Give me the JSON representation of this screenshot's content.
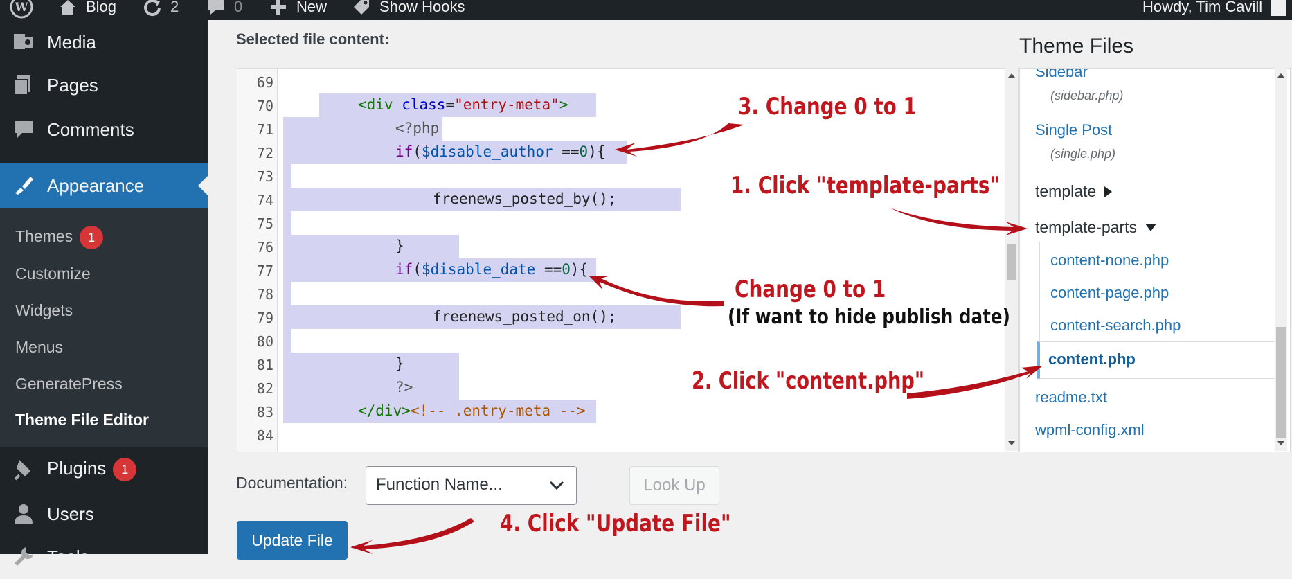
{
  "admin_bar": {
    "blog_label": "Blog",
    "updates_count": "2",
    "comments_count": "0",
    "new_label": "New",
    "hooks_label": "Show Hooks",
    "greeting": "Howdy, Tim Cavill"
  },
  "sidebar": {
    "media": "Media",
    "pages": "Pages",
    "comments": "Comments",
    "appearance": "Appearance",
    "submenu": [
      {
        "label": "Themes",
        "badge": "1"
      },
      {
        "label": "Customize"
      },
      {
        "label": "Widgets"
      },
      {
        "label": "Menus"
      },
      {
        "label": "GeneratePress"
      },
      {
        "label": "Theme File Editor"
      }
    ],
    "plugins": "Plugins",
    "plugins_badge": "1",
    "users": "Users",
    "tools": "Tools"
  },
  "editor": {
    "label": "Selected file content:",
    "line_numbers": [
      "69",
      "70",
      "71",
      "72",
      "73",
      "74",
      "75",
      "76",
      "77",
      "78",
      "79",
      "80",
      "81",
      "82",
      "83",
      "84"
    ]
  },
  "theme_files": {
    "title": "Theme Files",
    "sidebar_name": "Sidebar",
    "sidebar_file": "(sidebar.php)",
    "single_name": "Single Post",
    "single_file": "(single.php)",
    "folder_template": "template",
    "folder_template_parts": "template-parts",
    "files": [
      "content-none.php",
      "content-page.php",
      "content-search.php",
      "content.php"
    ],
    "readme": "readme.txt",
    "wpml": "wpml-config.xml"
  },
  "documentation": {
    "label": "Documentation:",
    "select_value": "Function Name...",
    "lookup": "Look Up"
  },
  "update_button": "Update File",
  "annotations": {
    "step3": "3. Change 0 to 1",
    "step1": "1. Click \"template-parts\"",
    "change": "Change 0 to 1",
    "note": "(If want to hide publish date)",
    "step2": "2. Click \"content.php\"",
    "step4": "4. Click \"Update File\""
  },
  "colors": {
    "admin_bg": "#1d2327",
    "accent": "#2271b1",
    "badge": "#d63638",
    "selection": "#d4d4f2",
    "annotation_red": "#c0161e"
  }
}
